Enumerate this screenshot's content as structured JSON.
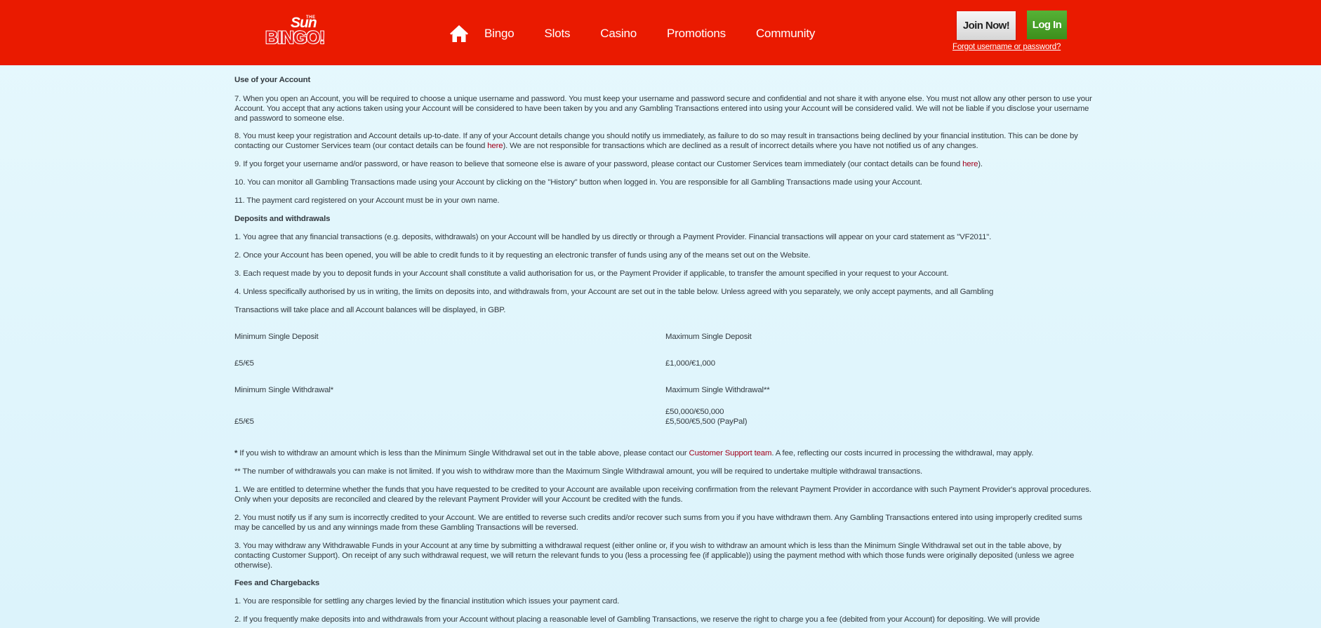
{
  "header": {
    "logo": {
      "the": "THE",
      "sun": "Sun",
      "bingo": "BINGO!"
    },
    "nav": [
      "Bingo",
      "Slots",
      "Casino",
      "Promotions",
      "Community"
    ],
    "join_label": "Join Now!",
    "login_label": "Log In",
    "forgot_label": "Forgot username or password?"
  },
  "colors": {
    "header_bg": "#ea1a00",
    "join_bg": "#e6e6e6",
    "login_bg": "#4aa02a",
    "link": "#a0001a"
  },
  "content": {
    "sec_use": "Use of your Account",
    "p7": "7. When you open an Account, you will be required to choose a unique username and password. You must keep your username and password secure and confidential and not share it with anyone else. You must not allow any other person to use your Account. You accept that any actions taken using your Account will be considered to have been taken by you and any Gambling Transactions entered into using your Account will be considered valid. We will not be liable if you disclose your username and password to someone else.",
    "p8_a": "8. You must keep your registration and Account details up-to-date. If any of your Account details change you should notify us immediately, as failure to do so may result in transactions being declined by your financial institution. This can be done by contacting our Customer Services team (our contact details can be found ",
    "p8_link": "here",
    "p8_b": "). We are not responsible for transactions which are declined as a result of incorrect details where you have not notified us of any changes.",
    "p9_a": "9. If you forget your username and/or password, or have reason to believe that someone else is aware of your password, please contact our Customer Services team immediately (our contact details can be found ",
    "p9_link": "here",
    "p9_b": ").",
    "p10": "10. You can monitor all Gambling Transactions made using your Account by clicking on the \"History\" button when logged in. You are responsible for all Gambling Transactions made using your Account.",
    "p11": "11. The payment card registered on your Account must be in your own name.",
    "sec_dep": "Deposits and withdrawals",
    "d1": "1. You agree that any financial transactions (e.g. deposits, withdrawals) on your Account will be handled by us directly or through a Payment Provider. Financial transactions will appear on your card statement as \"VF2011\".",
    "d2": "2. Once your Account has been opened, you will be able to credit funds to it by requesting an electronic transfer of funds using any of the means set out on the Website.",
    "d3": "3. Each request made by you to deposit funds in your Account shall constitute a valid authorisation for us, or the Payment Provider if applicable, to transfer the amount specified in your request to your Account.",
    "d4_a": "4. Unless specifically authorised by us in writing, the limits on deposits into, and withdrawals from, your Account are set out in the table below. Unless agreed with you separately, we only accept payments, and all Gambling",
    "d4_b": "Transactions will take place and all Account balances will be displayed, in GBP.",
    "table": {
      "min_dep_label": "Minimum Single Deposit",
      "max_dep_label": "Maximum Single Deposit",
      "min_dep_value": "£5/€5",
      "max_dep_value": "£1,000/€1,000",
      "min_wd_label": "Minimum Single Withdrawal*",
      "max_wd_label": "Maximum Single Withdrawal**",
      "min_wd_value": "£5/€5",
      "max_wd_value_1": "£50,000/€50,000",
      "max_wd_value_2": "£5,500/€5,500 (PayPal)"
    },
    "note1_star": "*",
    "note1_a": " If you wish to withdraw an amount which is less than the Minimum Single Withdrawal set out in the table above, please contact our ",
    "note1_link": "Customer Support team",
    "note1_b": ". A fee, reflecting our costs incurred in processing the withdrawal, may apply.",
    "note2": "** The number of withdrawals you can make is not limited. If you wish to withdraw more than the Maximum Single Withdrawal amount, you will be required to undertake multiple withdrawal transactions.",
    "w1": "1. We are entitled to determine whether the funds that you have requested to be credited to your Account are available upon receiving confirmation from the relevant Payment Provider in accordance with such Payment Provider's approval procedures. Only when your deposits are reconciled and cleared by the relevant Payment Provider will your Account be credited with the funds.",
    "w2": "2. You must notify us if any sum is incorrectly credited to your Account. We are entitled to reverse such credits and/or recover such sums from you if you have withdrawn them. Any Gambling Transactions entered into using improperly credited sums may be cancelled by us and any winnings made from these Gambling Transactions will be reversed.",
    "w3": "3. You may withdraw any Withdrawable Funds in your Account at any time by submitting a withdrawal request (either online or, if you wish to withdraw an amount which is less than the Minimum Single Withdrawal set out in the table above, by contacting Customer Support). On receipt of any such withdrawal request, we will return the relevant funds to you (less a processing fee (if applicable)) using the payment method with which those funds were originally deposited (unless we agree otherwise).",
    "sec_fees": "Fees and Chargebacks",
    "f1": "1. You are responsible for settling any charges levied by the financial institution which issues your payment card.",
    "f2": "2. If you frequently make deposits into and withdrawals from your Account without placing a reasonable level of Gambling Transactions, we reserve the right to charge you a fee (debited from your Account) for depositing. We will provide"
  }
}
